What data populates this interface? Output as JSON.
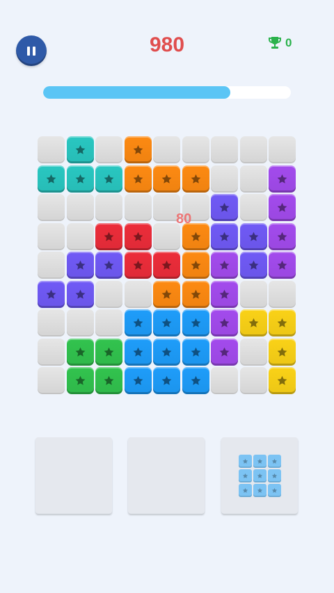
{
  "header": {
    "score": "980",
    "best_score": "0",
    "pause_icon": "pause-icon",
    "trophy_icon": "trophy-icon"
  },
  "progress": {
    "fraction": 0.755
  },
  "popup": {
    "points": "80"
  },
  "colors": {
    "teal": "#27bcb6",
    "orange": "#ef8211",
    "purple": "#9a47e0",
    "red": "#df2a37",
    "indigo": "#6a55e8",
    "blue": "#1c94ec",
    "green": "#2fb84a",
    "yellow": "#ecc616",
    "piece": "#7cc3f3"
  },
  "board": {
    "rows": [
      [
        ".",
        "T",
        ".",
        "O",
        ".",
        ".",
        ".",
        ".",
        "."
      ],
      [
        "T",
        "T",
        "T",
        "O",
        "O",
        "O",
        ".",
        ".",
        "P"
      ],
      [
        ".",
        ".",
        ".",
        ".",
        ".",
        ".",
        "I",
        ".",
        "P"
      ],
      [
        ".",
        ".",
        "R",
        "R",
        ".",
        "O",
        "I",
        "I",
        "P"
      ],
      [
        ".",
        "I",
        "I",
        "R",
        "R",
        "O",
        "P",
        "I",
        "P"
      ],
      [
        "I",
        "I",
        ".",
        ".",
        "O",
        "O",
        "P",
        ".",
        "."
      ],
      [
        ".",
        ".",
        ".",
        "B",
        "B",
        "B",
        "P",
        "Y",
        "Y"
      ],
      [
        ".",
        "G",
        "G",
        "B",
        "B",
        "B",
        "P",
        ".",
        "Y"
      ],
      [
        ".",
        "G",
        "G",
        "B",
        "B",
        "B",
        ".",
        ".",
        "Y"
      ]
    ]
  },
  "pieces": [
    {
      "slot": "left",
      "shape": []
    },
    {
      "slot": "middle",
      "shape": []
    },
    {
      "slot": "right",
      "shape": [
        [
          1,
          1,
          1
        ],
        [
          1,
          1,
          1
        ],
        [
          1,
          1,
          1
        ]
      ]
    }
  ]
}
